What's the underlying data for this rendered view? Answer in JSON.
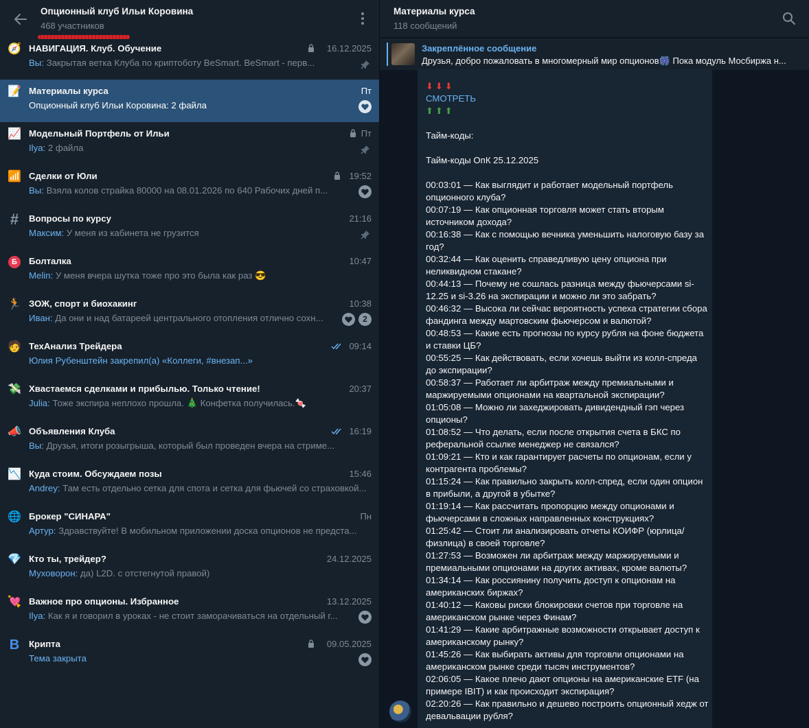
{
  "group": {
    "title": "Опционный клуб Ильи Коровина",
    "members": "468 участников"
  },
  "topics": [
    {
      "icon": "compass-icon",
      "glyph": "🧭",
      "title": "НАВИГАЦИЯ. Клуб. Обучение",
      "time": "16.12.2025",
      "lock": true,
      "sender": "Вы:",
      "preview": " Закрытая ветка Клуба по криптоботу BeSmart.  BeSmart - перв...",
      "indicator": "pin"
    },
    {
      "icon": "notepad-icon",
      "glyph": "📝",
      "title": "Материалы курса",
      "time": "Пт",
      "lock": false,
      "sender": "",
      "preview": "Опционный клуб Ильи Коровина: 2 файла",
      "indicator": "heart",
      "active": true
    },
    {
      "icon": "chart-up-icon",
      "glyph": "📈",
      "title": "Модельный Портфель от Ильи",
      "time": "Пт",
      "lock": true,
      "sender": "Ilya:",
      "preview": " 2 файла",
      "indicator": "pin"
    },
    {
      "icon": "signal-bars-icon",
      "glyph": "📶",
      "title": "Сделки от Юли",
      "time": "19:52",
      "lock": true,
      "sender": "Вы:",
      "preview": " Взяла колов страйка 80000 на 08.01.2026 по 640  Рабочих дней п...",
      "indicator": "heart"
    },
    {
      "icon": "hash-icon",
      "glyph": "#",
      "title": "Вопросы по курсу",
      "time": "21:16",
      "lock": false,
      "sender": "Максим:",
      "preview": " У меня из кабинета не грузится",
      "indicator": "pin"
    },
    {
      "icon": "b-letter-icon",
      "glyph": "Б",
      "title": "Болталка",
      "time": "10:47",
      "lock": false,
      "sender": "Melin:",
      "preview": " У меня вчера шутка тоже про это была как раз 😎",
      "indicator": "none"
    },
    {
      "icon": "runner-icon",
      "glyph": "🏃",
      "title": "ЗОЖ, спорт и биохакинг",
      "time": "10:38",
      "lock": false,
      "sender": "Иван:",
      "preview": " Да они и над батареей центрального отопления отлично сохн...",
      "indicator": "heart-badge",
      "badge": "2"
    },
    {
      "icon": "face-icon",
      "glyph": "🧑",
      "title": "ТехАнализ Трейдера",
      "time": "09:14",
      "lock": false,
      "checks": true,
      "sender": "",
      "preview": "Юлия Рубенштейн закрепил(а) «Коллеги, #внезап...»",
      "indicator": "none",
      "previewLink": true
    },
    {
      "icon": "money-icon",
      "glyph": "💸",
      "title": "Хвастаемся сделками и прибылью. Только чтение!",
      "time": "20:37",
      "lock": false,
      "sender": "Julia:",
      "preview": "  Тоже экспира неплохо прошла. 🎄 Конфетка получилась.🍬",
      "indicator": "none"
    },
    {
      "icon": "megaphone-icon",
      "glyph": "📣",
      "title": "Объявления Клуба",
      "time": "16:19",
      "lock": false,
      "checks": true,
      "sender": "Вы:",
      "preview": " Друзья, итоги розыгрыша, который был проведен вчера на стриме...",
      "indicator": "none"
    },
    {
      "icon": "chart-down-icon",
      "glyph": "📉",
      "title": "Куда стоим. Обсуждаем позы",
      "time": "15:46",
      "lock": false,
      "sender": "Andrey:",
      "preview": " Там есть отдельно сетка для спота и сетка для фьючей со страховкой...",
      "indicator": "none"
    },
    {
      "icon": "globe-icon",
      "glyph": "🌐",
      "title": "Брокер \"СИНАРА\"",
      "time": "Пн",
      "lock": false,
      "sender": "Артур:",
      "preview": " Здравствуйте! В мобильном приложении доска опционов не предста...",
      "indicator": "none"
    },
    {
      "icon": "diamond-icon",
      "glyph": "💎",
      "title": "Кто ты, трейдер?",
      "time": "24.12.2025",
      "lock": false,
      "sender": "Муховорон:",
      "preview": " да) L2D. с отстегнутой правой)",
      "indicator": "none"
    },
    {
      "icon": "hearts-icon",
      "glyph": "💘",
      "title": "Важное про опционы. Избранное",
      "time": "13.12.2025",
      "lock": false,
      "sender": "Ilya:",
      "preview": " Как я и говорил в уроках - не стоит заморачиваться на отдельный г...",
      "indicator": "heart"
    },
    {
      "icon": "b-blue-icon",
      "glyph": "B",
      "title": "Крипта",
      "time": "09.05.2025",
      "lock": true,
      "sender": "",
      "preview": "Тема закрыта",
      "indicator": "heart",
      "previewLink": true
    }
  ],
  "channel": {
    "title": "Материалы курса",
    "count": "118 сообщений"
  },
  "pinned": {
    "label": "Закреплённое сообщение",
    "text": "Друзья, добро пожаловать в многомерный мир опционов🎆 Пока модуль Мосбиржа н..."
  },
  "message": {
    "arrows_red": "⬇⬇⬇",
    "watch": "СМОТРЕТЬ",
    "arrows_green": "⬆⬆⬆",
    "timecodes_label": "Тайм-коды:",
    "timecodes_date": "Тайм-коды ОпК 25.12.2025",
    "lines": [
      "00:03:01 — Как выглядит и работает модельный портфель опционного клуба?",
      "00:07:19 — Как опционная торговля может стать вторым источником дохода?",
      "00:16:38 — Как с помощью вечника уменьшить налоговую базу за год?",
      "00:32:44 — Как оценить справедливую цену опциона при неликвидном стакане?",
      "00:44:13 — Почему не сошлась разница между фьючерсами si-12.25 и si-3.26 на экспирации и можно ли это забрать?",
      "00:46:32 — Высока ли сейчас вероятность успеха стратегии сбора фандинга между мартовским фьючерсом и валютой?",
      "00:48:53 — Какие есть прогнозы по курсу рубля на фоне бюджета и ставки ЦБ?",
      "00:55:25 — Как действовать, если хочешь выйти из колл-спреда до экспирации?",
      "00:58:37 — Работает ли арбитраж между премиальными и маржируемыми опционами на квартальной экспирации?",
      "01:05:08 — Можно ли захеджировать дивидендный гэп через опционы?",
      "01:08:52 — Что делать, если после открытия счета в БКС по реферальной ссылке менеджер не связался?",
      "01:09:21 — Кто и как гарантирует расчеты по опционам, если у контрагента проблемы?",
      "01:15:24 — Как правильно закрыть колл-спред, если один опцион в прибыли, а другой в убытке?",
      "01:19:14 — Как рассчитать пропорцию между опционами и фьючерсами в сложных направленных конструкциях?",
      "01:25:42 — Стоит ли анализировать отчеты КОИФР (юрлица/физлица) в своей торговле?",
      "01:27:53 — Возможен ли арбитраж между маржируемыми и премиальными опционами на других активах, кроме валюты?",
      "01:34:14 — Как россиянину получить доступ к опционам на американских биржах?",
      "01:40:12 — Каковы риски блокировки счетов при торговле на американском рынке через Финам?",
      "01:41:29 — Какие арбитражные возможности открывает доступ к американскому рынку?",
      "01:45:26 — Как выбирать активы для торговли опционами на американском рынке среди тысяч инструментов?",
      "02:06:05 — Какое плечо дают опционы на американские ETF (на примере IBIT) и как происходит экспирация?",
      "02:20:26 — Как правильно и дешево построить опционный хедж от девальвации рубля?"
    ]
  },
  "colors": {
    "accent": "#6ab3f3",
    "active_row": "#2b5278",
    "sidebar_bg": "#17212b",
    "chat_bg": "#0e1621",
    "bubble_bg": "#182533"
  }
}
